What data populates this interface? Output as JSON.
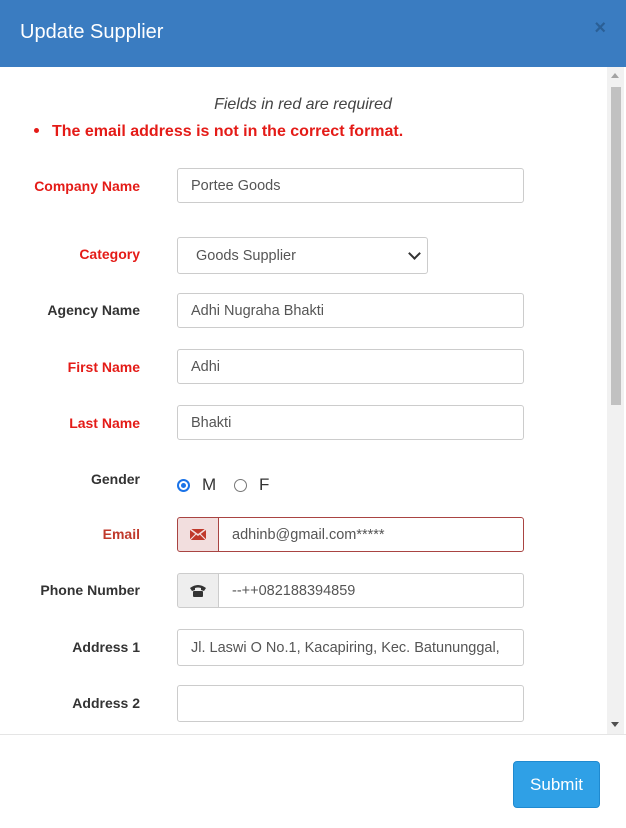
{
  "modal": {
    "title": "Update Supplier",
    "close": "×"
  },
  "form": {
    "hint": "Fields in red are required",
    "error": "The email address is not in the correct format.",
    "company_name": {
      "label": "Company Name",
      "value": "Portee Goods"
    },
    "category": {
      "label": "Category",
      "value": "Goods Supplier"
    },
    "agency_name": {
      "label": "Agency Name",
      "value": "Adhi Nugraha Bhakti"
    },
    "first_name": {
      "label": "First Name",
      "value": "Adhi"
    },
    "last_name": {
      "label": "Last Name",
      "value": "Bhakti"
    },
    "gender": {
      "label": "Gender",
      "options": [
        "M",
        "F"
      ],
      "selected": "M"
    },
    "email": {
      "label": "Email",
      "value": "adhinb@gmail.com*****",
      "icon": "envelope-icon"
    },
    "phone": {
      "label": "Phone Number",
      "value": "--++082188394859",
      "icon": "phone-icon"
    },
    "address1": {
      "label": "Address 1",
      "value": "Jl. Laswi O No.1, Kacapiring, Kec. Batununggal,"
    },
    "address2": {
      "label": "Address 2",
      "value": ""
    }
  },
  "footer": {
    "submit_label": "Submit"
  },
  "colors": {
    "header": "#3a7cc1",
    "required": "#e41b17",
    "error_border": "#a94442",
    "submit": "#2fa0e6"
  }
}
